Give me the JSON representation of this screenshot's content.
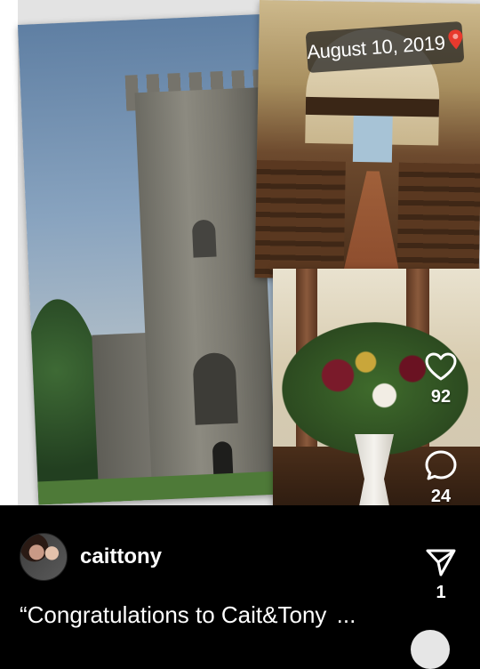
{
  "story": {
    "date_label": "August 10, 2019",
    "date_pin_icon": "map-pin-heart-icon"
  },
  "actions": {
    "like_icon": "heart-outline-icon",
    "like_count": "92",
    "comment_icon": "comment-bubble-icon",
    "comment_count": "24",
    "share_icon": "paper-plane-icon",
    "share_count": "1"
  },
  "post": {
    "username": "caittony",
    "caption": "“Congratulations to Cait&Tony",
    "caption_more": "..."
  },
  "colors": {
    "background": "#000000",
    "text": "#ffffff",
    "pin": "#e8392d"
  }
}
